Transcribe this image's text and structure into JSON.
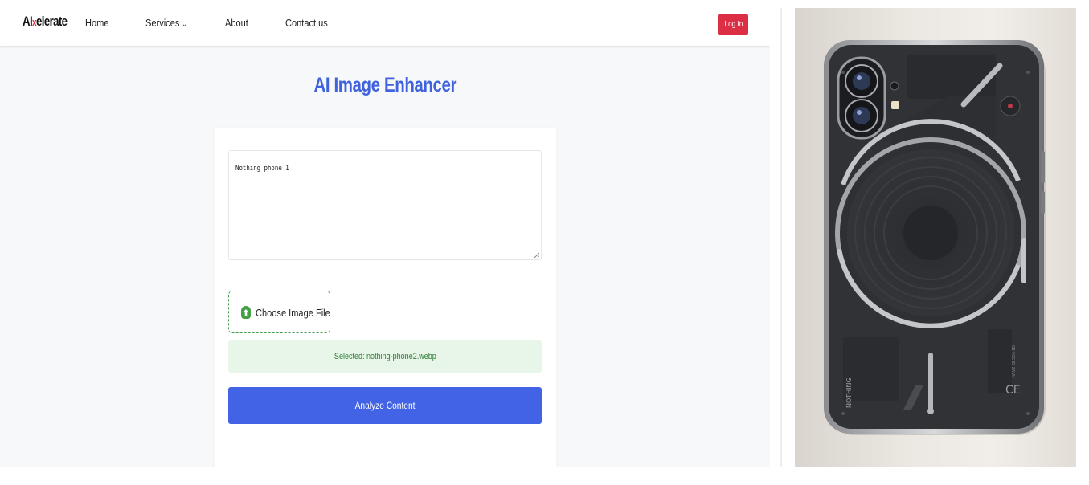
{
  "navbar": {
    "logo": {
      "prefix": "AI",
      "x": "x",
      "suffix": "elerate"
    },
    "links": [
      {
        "label": "Home"
      },
      {
        "label": "Services",
        "dropdown": true
      },
      {
        "label": "About"
      },
      {
        "label": "Contact us"
      }
    ],
    "login_label": "Log In"
  },
  "main": {
    "title": "AI Image Enhancer",
    "prompt_text": "Nothing phone 1",
    "choose_file_label": "Choose Image File",
    "selected_file_text": "Selected: nothing-phone2.webp",
    "analyze_label": "Analyze Content"
  },
  "preview": {
    "phone_back_text": "NOTHING"
  },
  "colors": {
    "accent": "#4263e6",
    "title": "#4062dc",
    "login": "#dc2f45",
    "success_bg": "#e8f5e9",
    "success_text": "#2e7d32",
    "dashed_border": "#3f9b4d"
  },
  "icons": {
    "upload": "upload-cloud-icon",
    "chevron": "chevron-down-icon"
  }
}
